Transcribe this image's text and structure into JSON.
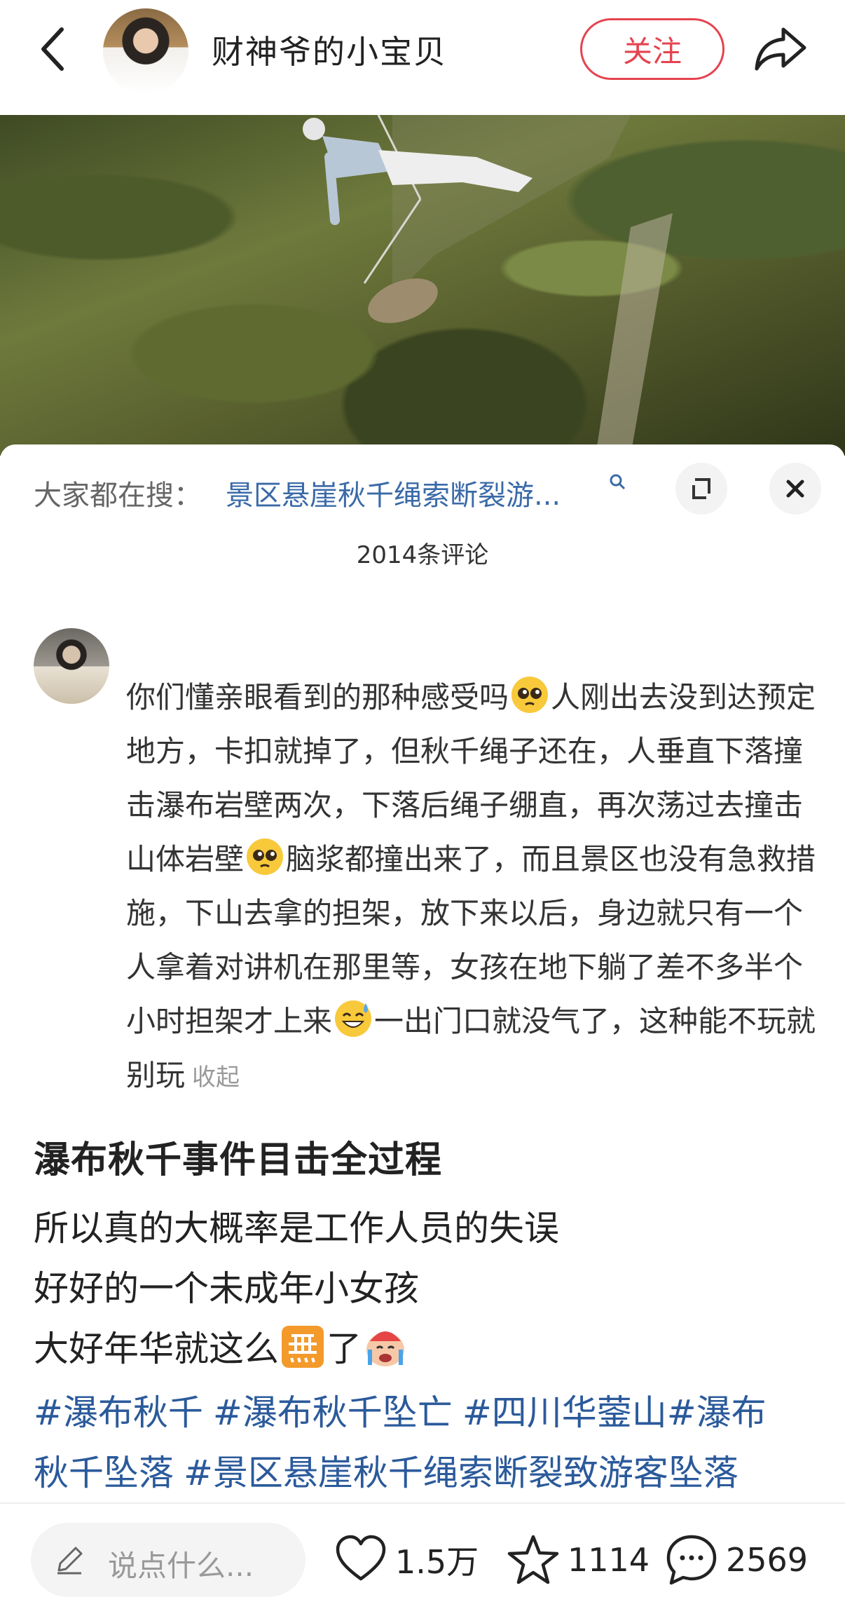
{
  "header": {
    "user_name": "财神爷的小宝贝",
    "follow_label": "关注"
  },
  "search_bar": {
    "label": "大家都在搜：",
    "query": "景区悬崖秋千绳索断裂游..."
  },
  "comments": {
    "count_label": "2014条评论",
    "top_comment": {
      "text_1": "你们懂亲眼看到的那种感受吗",
      "text_2": "人刚出去没到达预定地方，卡扣就掉了，但秋千绳子还在，人垂直下落撞击瀑布岩壁两次，下落后绳子绷直，再次荡过去撞击山体岩壁",
      "text_3": "脑浆都撞出来了，而且景区也没有急救措施，下山去拿的担架，放下来以后，身边就只有一个人拿着对讲机在那里等，女孩在地下躺了差不多半个小时担架才上来",
      "text_4": "一出门口就没气了，这种能不玩就别玩",
      "collapse_label": "收起"
    }
  },
  "post": {
    "title": "瀑布秋千事件目击全过程",
    "line_1": "所以真的大概率是工作人员的失误",
    "line_2": "好好的一个未成年小女孩",
    "line_3_a": "大好年华就这么",
    "line_3_b": "了",
    "tags": [
      "#瀑布秋千",
      "#瀑布秋千坠亡",
      "#四川华蓥山#瀑布",
      "秋千坠落",
      "#景区悬崖秋千绳索断裂致游客坠落"
    ]
  },
  "bottom_bar": {
    "input_placeholder": "说点什么...",
    "likes": "1.5万",
    "collects": "1114",
    "comments": "2569"
  }
}
